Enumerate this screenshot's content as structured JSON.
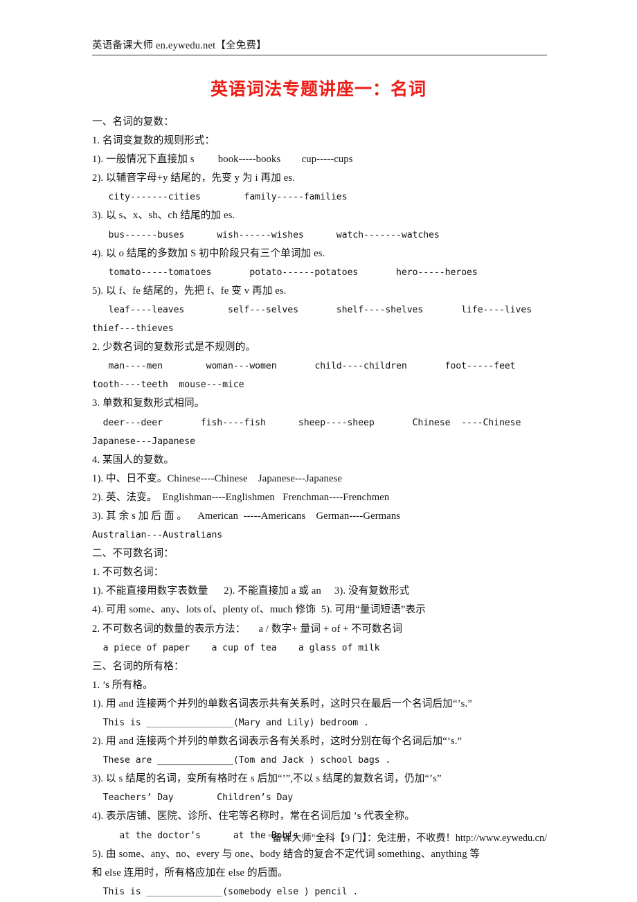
{
  "header": {
    "text": "英语备课大师  en.eywedu.net【全免费】"
  },
  "title": {
    "text": "英语词法专题讲座一：名词",
    "color": "#ee1c16"
  },
  "footer": {
    "text": "\"备课大师\"全科【9 门】：免注册，不收费！http://www.eywedu.cn/"
  },
  "body": {
    "lines": [
      {
        "id": "l01",
        "text": "一、名词的复数："
      },
      {
        "id": "l02",
        "text": "1. 名词变复数的规则形式："
      },
      {
        "id": "l03",
        "text": "1). 一般情况下直接加 s         book-----books        cup-----cups"
      },
      {
        "id": "l04",
        "text": "2). 以辅音字母+y 结尾的，先变 y 为 i 再加 es."
      },
      {
        "id": "l05",
        "text": "   city-------cities        family-----families"
      },
      {
        "id": "l06",
        "text": "3). 以 s、x、sh、ch 结尾的加 es."
      },
      {
        "id": "l07",
        "text": "   bus------buses      wish------wishes      watch-------watches"
      },
      {
        "id": "l08",
        "text": "4). 以 o 结尾的多数加 S 初中阶段只有三个单词加 es."
      },
      {
        "id": "l09",
        "text": "   tomato-----tomatoes       potato------potatoes       hero-----heroes"
      },
      {
        "id": "l10",
        "text": "5). 以 f、fe 结尾的，先把 f、fe 变 v 再加 es."
      },
      {
        "id": "l11",
        "text": "   leaf----leaves        self---selves       shelf----shelves       life----lives"
      },
      {
        "id": "l12",
        "text": "thief---thieves"
      },
      {
        "id": "l13",
        "text": "2. 少数名词的复数形式是不规则的。"
      },
      {
        "id": "l14",
        "text": "   man----men        woman---women       child----children       foot-----feet"
      },
      {
        "id": "l15",
        "text": "tooth----teeth  mouse---mice"
      },
      {
        "id": "l16",
        "text": "3. 单数和复数形式相同。"
      },
      {
        "id": "l17",
        "text": "  deer---deer       fish----fish      sheep----sheep       Chinese  ----Chinese"
      },
      {
        "id": "l18",
        "text": "Japanese---Japanese"
      },
      {
        "id": "l19",
        "text": "4. 某国人的复数。"
      },
      {
        "id": "l20",
        "text": "1). 中、日不变。Chinese----Chinese    Japanese---Japanese"
      },
      {
        "id": "l21",
        "text": "2). 英、法变。  Englishman----Englishmen   Frenchman----Frenchmen"
      },
      {
        "id": "l22",
        "text": "3). 其 余 s 加 后 面 。    American  -----Americans    German----Germans"
      },
      {
        "id": "l23",
        "text": "Australian---Australians"
      },
      {
        "id": "l24",
        "text": "二、不可数名词："
      },
      {
        "id": "l25",
        "text": "1. 不可数名词："
      },
      {
        "id": "l26",
        "text": "1). 不能直接用数字表数量      2). 不能直接加 a 或 an     3). 没有复数形式"
      },
      {
        "id": "l27",
        "text": "4). 可用 some、any、lots of、plenty of、much 修饰  5). 可用“量词短语”表示"
      },
      {
        "id": "l28",
        "text": "2. 不可数名词的数量的表示方法：     a / 数字+ 量词 + of + 不可数名词"
      },
      {
        "id": "l29",
        "text": "  a piece of paper    a cup of tea    a glass of milk"
      },
      {
        "id": "l30",
        "text": "三、名词的所有格："
      },
      {
        "id": "l31",
        "text": "1. ’s 所有格。"
      },
      {
        "id": "l32",
        "text": "1). 用 and 连接两个并列的单数名词表示共有关系时，这时只在最后一个名词后加“’s.”"
      },
      {
        "id": "l33",
        "text": "  This is ________________(Mary and Lily) bedroom ."
      },
      {
        "id": "l34",
        "text": "2). 用 and 连接两个并列的单数名词表示各有关系时，这时分别在每个名词后加“’s.”"
      },
      {
        "id": "l35",
        "text": "  These are ______________(Tom and Jack ) school bags ."
      },
      {
        "id": "l36",
        "text": "3). 以 s 结尾的名词，变所有格时在 s 后加“’”,不以 s 结尾的复数名词，仍加“’s”"
      },
      {
        "id": "l37",
        "text": "  Teachers’ Day        Children’s Day"
      },
      {
        "id": "l38",
        "text": "4). 表示店铺、医院、诊所、住宅等名称时，常在名词后加 ’s 代表全称。"
      },
      {
        "id": "l39",
        "text": "     at the doctor’s      at the Bob’s"
      },
      {
        "id": "l40",
        "text": "5). 由 some、any、no、every 与 one、body 结合的复合不定代词 something、anything 等"
      },
      {
        "id": "l41",
        "text": "和 else 连用时，所有格应加在 else 的后面。"
      },
      {
        "id": "l42",
        "text": "  This is ______________(somebody else ) pencil ."
      }
    ]
  }
}
